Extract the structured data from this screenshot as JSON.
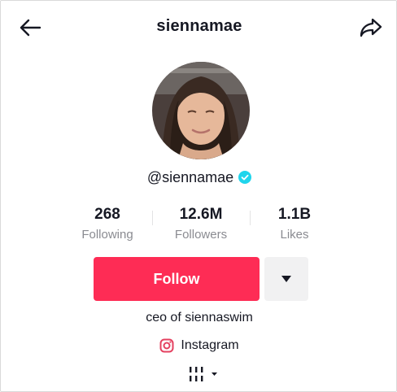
{
  "header": {
    "title": "siennamae"
  },
  "profile": {
    "handle": "@siennamae",
    "verified": true,
    "accent_color": "#20d5ec"
  },
  "stats": {
    "following": {
      "value": "268",
      "label": "Following"
    },
    "followers": {
      "value": "12.6M",
      "label": "Followers"
    },
    "likes": {
      "value": "1.1B",
      "label": "Likes"
    }
  },
  "actions": {
    "follow_label": "Follow",
    "follow_color": "#fe2c55"
  },
  "bio": {
    "text": "ceo of siennaswim",
    "link_label": "Instagram",
    "link_icon": "instagram-icon"
  },
  "tabs": {
    "icon": "grid-tabs-icon"
  }
}
